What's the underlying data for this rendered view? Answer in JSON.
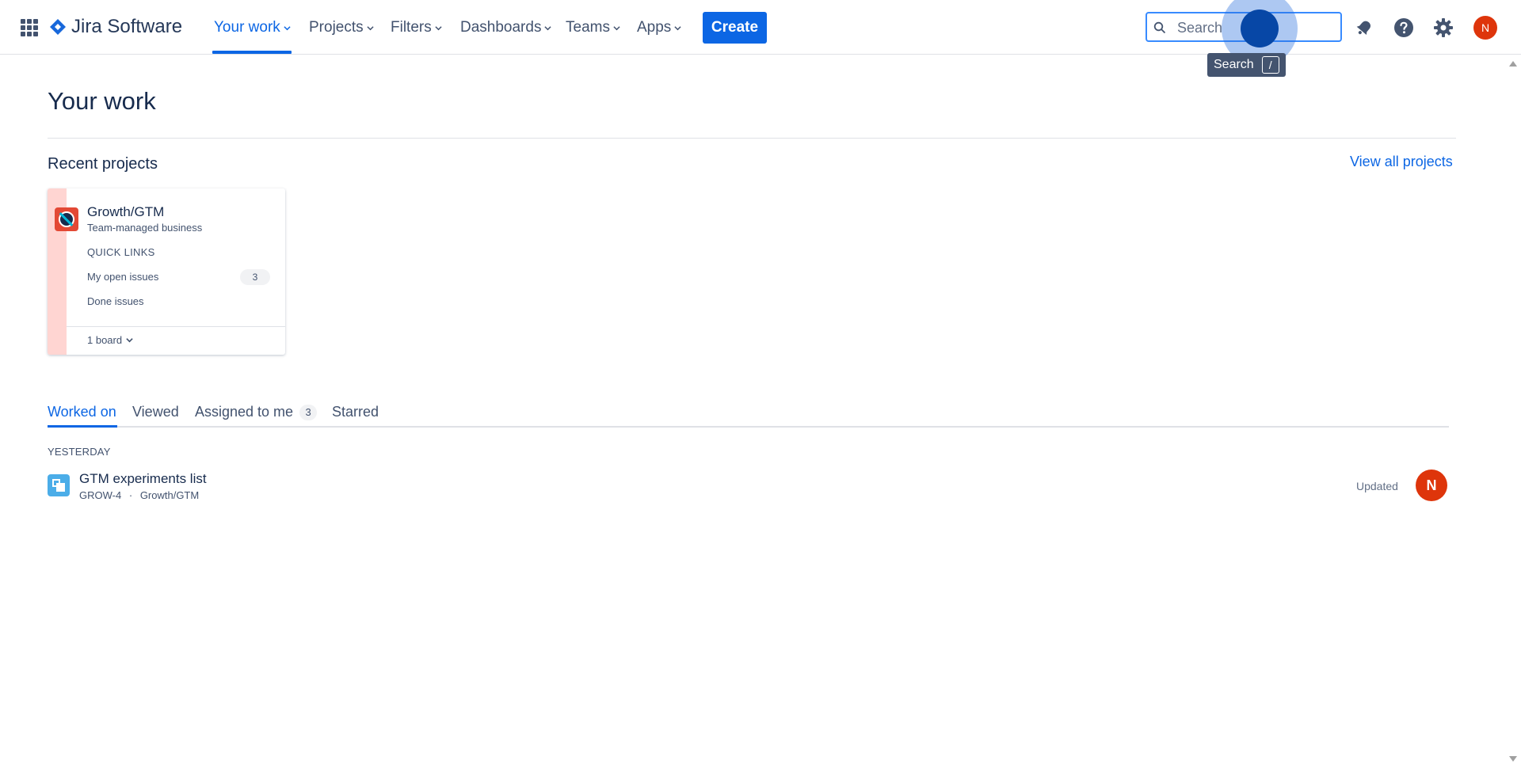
{
  "topnav": {
    "product_name": "Jira Software",
    "items": [
      {
        "label": "Your work"
      },
      {
        "label": "Projects"
      },
      {
        "label": "Filters"
      },
      {
        "label": "Dashboards"
      },
      {
        "label": "Teams"
      },
      {
        "label": "Apps"
      }
    ],
    "create_label": "Create",
    "search": {
      "placeholder": "Search",
      "tooltip_label": "Search",
      "tooltip_shortcut": "/"
    },
    "user_initial": "N",
    "icons": [
      "app-switcher-icon",
      "jira-logo-icon",
      "notifications-icon",
      "help-icon",
      "settings-icon"
    ]
  },
  "page": {
    "title": "Your work",
    "recent_projects": {
      "heading": "Recent projects",
      "view_all_label": "View all projects",
      "projects": [
        {
          "name": "Growth/GTM",
          "type": "Team-managed business",
          "quick_links_heading": "QUICK LINKS",
          "links": [
            {
              "label": "My open issues",
              "count": "3"
            },
            {
              "label": "Done issues"
            }
          ],
          "boards_label": "1 board"
        }
      ]
    },
    "tabs": [
      {
        "label": "Worked on",
        "active": true
      },
      {
        "label": "Viewed"
      },
      {
        "label": "Assigned to me",
        "count": "3"
      },
      {
        "label": "Starred"
      }
    ],
    "activity": {
      "group_label": "YESTERDAY",
      "items": [
        {
          "title": "GTM experiments list",
          "key": "GROW-4",
          "separator": "·",
          "project": "Growth/GTM",
          "action": "Updated",
          "user_initial": "N"
        }
      ]
    }
  },
  "colors": {
    "accent": "#0c66e4",
    "avatar": "#de350b",
    "project_strip": "#ffd5d2"
  }
}
